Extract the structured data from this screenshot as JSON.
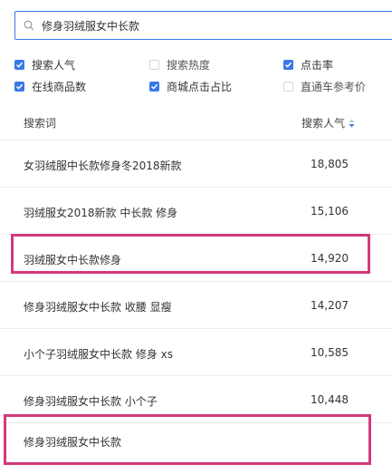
{
  "search": {
    "value": "修身羽绒服女中长款",
    "placeholder": ""
  },
  "filters": [
    {
      "label": "搜索人气",
      "checked": true
    },
    {
      "label": "搜索热度",
      "checked": false
    },
    {
      "label": "点击率",
      "checked": true
    },
    {
      "label": "在线商品数",
      "checked": true
    },
    {
      "label": "商城点击占比",
      "checked": true
    },
    {
      "label": "直通车参考价",
      "checked": false
    }
  ],
  "table": {
    "headers": {
      "keyword": "搜索词",
      "popularity": "搜索人气"
    },
    "rows": [
      {
        "keyword": "女羽绒服中长款修身冬2018新款",
        "popularity": "18,805"
      },
      {
        "keyword": "羽绒服女2018新款 中长款 修身",
        "popularity": "15,106"
      },
      {
        "keyword": "羽绒服女中长款修身",
        "popularity": "14,920"
      },
      {
        "keyword": "修身羽绒服女中长款 收腰 显瘦",
        "popularity": "14,207"
      },
      {
        "keyword": "小个子羽绒服女中长款 修身 xs",
        "popularity": "10,585"
      },
      {
        "keyword": "修身羽绒服女中长款 小个子",
        "popularity": "10,448"
      },
      {
        "keyword": "修身羽绒服女中长款",
        "popularity": ""
      }
    ]
  },
  "colors": {
    "accent": "#3b78e7",
    "highlight": "#d13a7b"
  }
}
